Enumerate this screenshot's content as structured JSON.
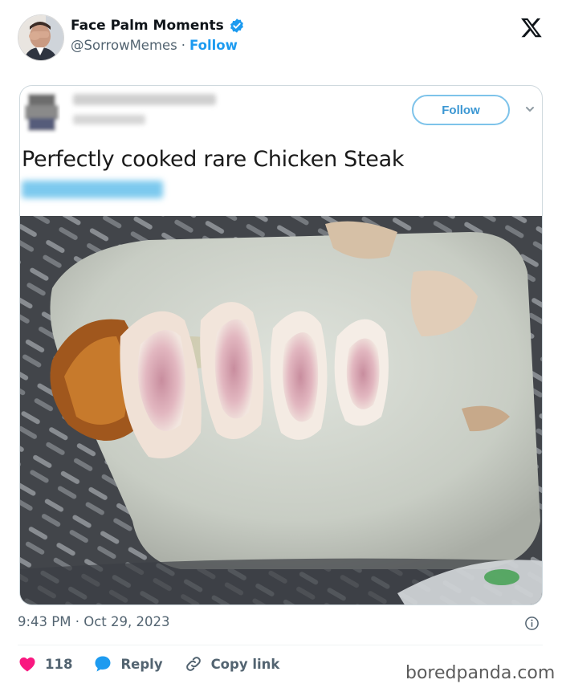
{
  "author": {
    "display_name": "Face Palm Moments",
    "handle": "@SorrowMemes",
    "separator": "·",
    "follow_label": "Follow"
  },
  "colors": {
    "accent": "#1d9bf0",
    "like": "#f91880",
    "muted": "#536471"
  },
  "icons": {
    "verified": "verified-badge-icon",
    "platform": "x-logo-icon",
    "info": "info-icon",
    "like": "heart-icon",
    "reply": "reply-bubble-icon",
    "copy": "link-icon"
  },
  "embedded": {
    "follow_label": "Follow",
    "text": "Perfectly cooked rare Chicken Steak"
  },
  "timestamp": "9:43 PM · Oct 29, 2023",
  "actions": {
    "like_count": "118",
    "reply_label": "Reply",
    "copy_label": "Copy link"
  },
  "watermark": "boredpanda.com"
}
